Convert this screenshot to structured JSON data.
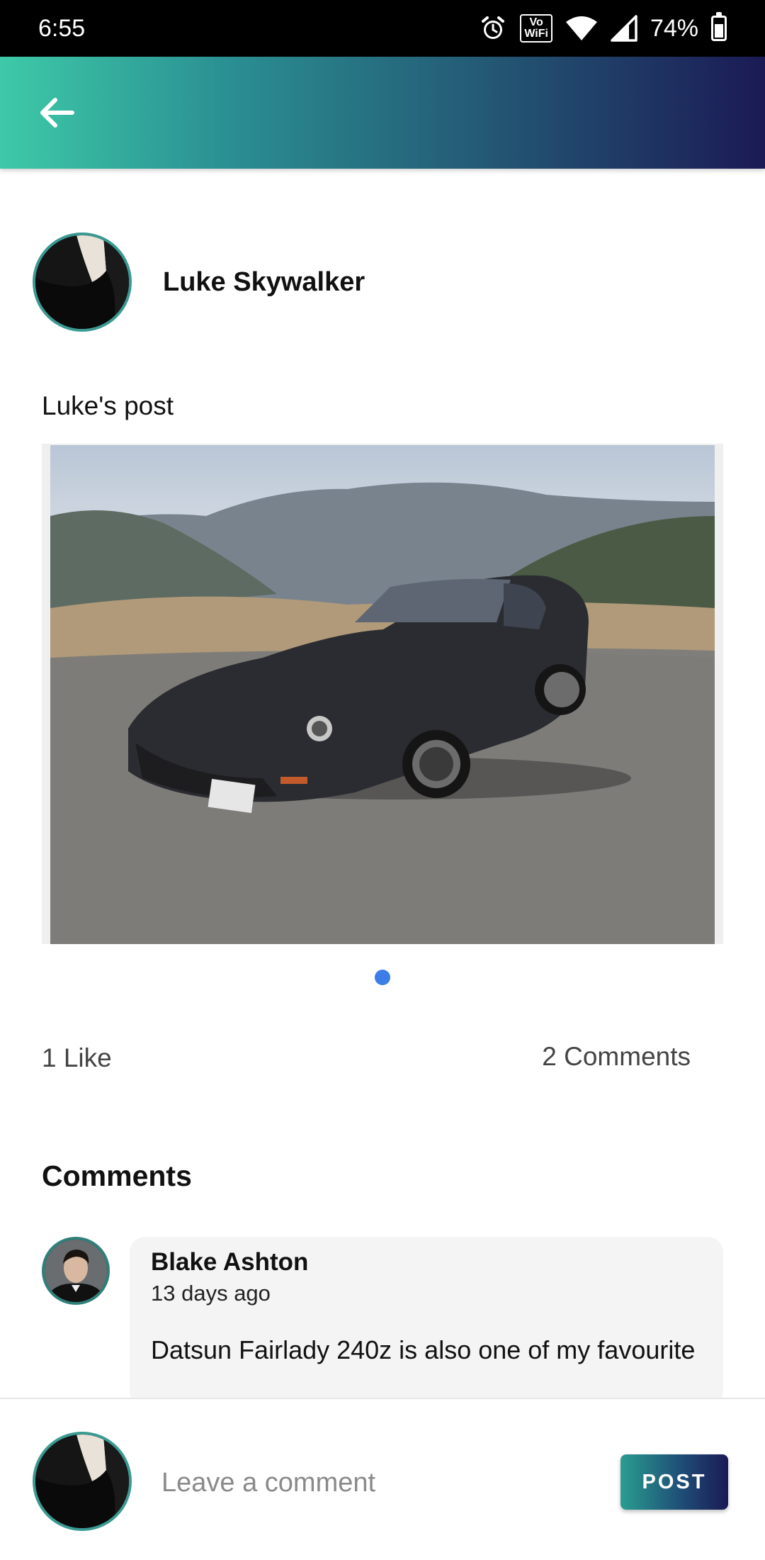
{
  "status_bar": {
    "time": "6:55",
    "battery": "74%",
    "battery_level": 0.74,
    "volte_top": "Vo",
    "volte_bottom": "WiFi",
    "icons": [
      "alarm-icon",
      "volte-wifi-icon",
      "wifi-icon",
      "signal-icon",
      "battery-icon"
    ]
  },
  "app_bar": {
    "back_icon": "arrow-left-icon",
    "gradient": [
      "#3ec9a8",
      "#245b76",
      "#1b1a55"
    ]
  },
  "post": {
    "author": "Luke Skywalker",
    "text": "Luke's post",
    "image": "black-datsun-240z-photo",
    "active_page_dot_color": "#3d7de8",
    "likes": "1 Like",
    "comments_count": "2 Comments"
  },
  "comments": {
    "title": "Comments",
    "items": [
      {
        "name": "Blake Ashton",
        "time": "13 days ago",
        "text": "Datsun Fairlady 240z is also one of my favourite"
      }
    ]
  },
  "composer": {
    "placeholder": "Leave a comment",
    "post_label": "POST"
  }
}
